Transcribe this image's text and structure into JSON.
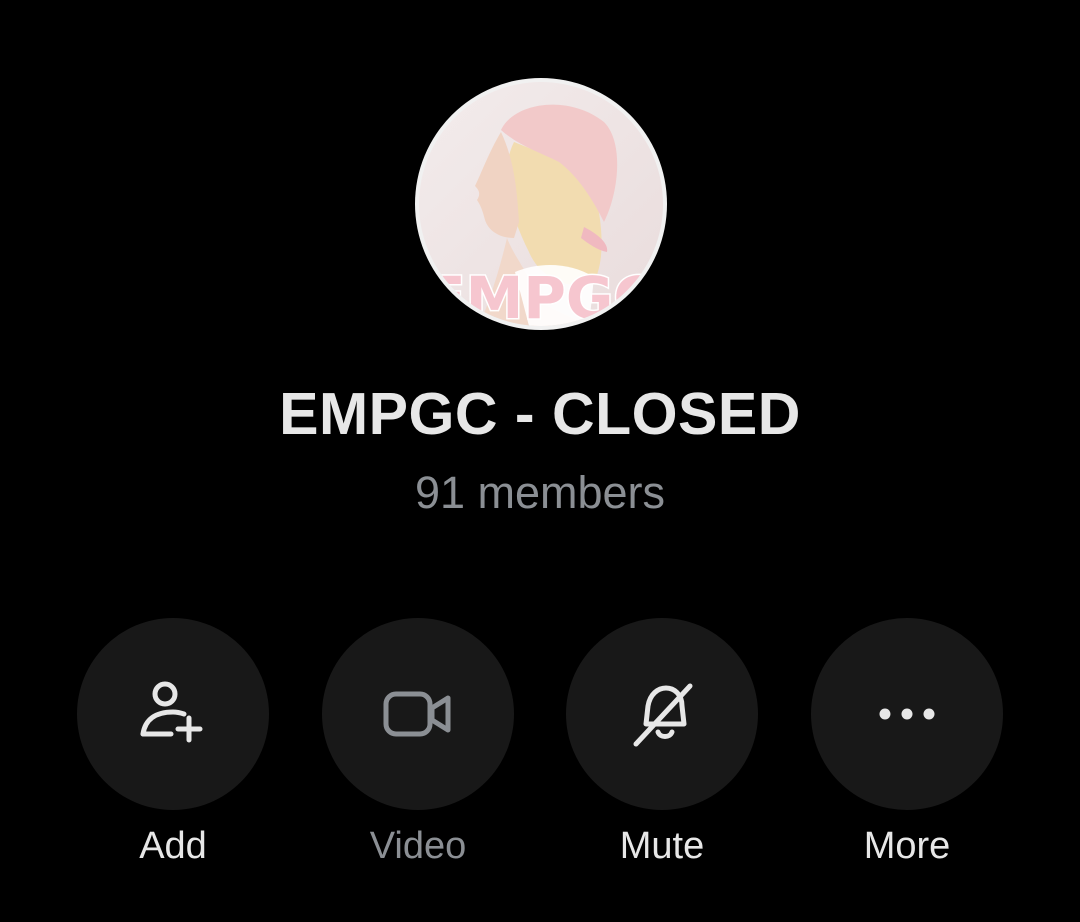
{
  "group": {
    "name": "EMPGC - CLOSED",
    "members": "91 members",
    "avatar_text": "EMPGC"
  },
  "actions": [
    {
      "label": "Add",
      "icon": "add-person-icon",
      "enabled": true
    },
    {
      "label": "Video",
      "icon": "video-camera-icon",
      "enabled": false
    },
    {
      "label": "Mute",
      "icon": "bell-off-icon",
      "enabled": true
    },
    {
      "label": "More",
      "icon": "more-dots-icon",
      "enabled": true
    }
  ],
  "colors": {
    "background": "#000000",
    "button_fill": "#181818",
    "primary_text": "#e7e7e7",
    "secondary_text": "#8b8f94",
    "avatar_pink": "#f6c6cf"
  }
}
